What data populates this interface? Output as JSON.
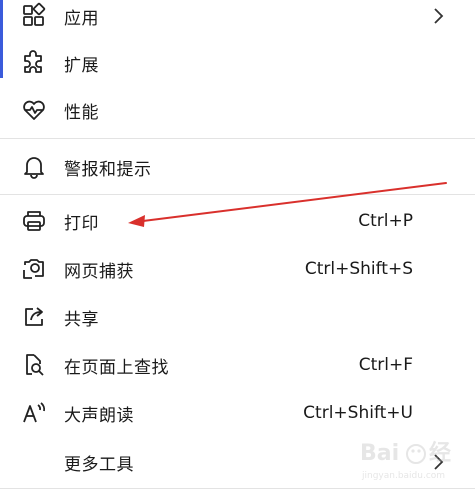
{
  "menu": {
    "items": [
      {
        "label": "应用",
        "shortcut": "",
        "icon": "apps-icon",
        "submenu": true
      },
      {
        "label": "扩展",
        "shortcut": "",
        "icon": "extensions-icon",
        "submenu": false
      },
      {
        "label": "性能",
        "shortcut": "",
        "icon": "performance-icon",
        "submenu": false
      },
      {
        "label": "警报和提示",
        "shortcut": "",
        "icon": "bell-icon",
        "submenu": false
      },
      {
        "label": "打印",
        "shortcut": "Ctrl+P",
        "icon": "printer-icon",
        "submenu": false
      },
      {
        "label": "网页捕获",
        "shortcut": "Ctrl+Shift+S",
        "icon": "web-capture-icon",
        "submenu": false
      },
      {
        "label": "共享",
        "shortcut": "",
        "icon": "share-icon",
        "submenu": false
      },
      {
        "label": "在页面上查找",
        "shortcut": "Ctrl+F",
        "icon": "find-on-page-icon",
        "submenu": false
      },
      {
        "label": "大声朗读",
        "shortcut": "Ctrl+Shift+U",
        "icon": "read-aloud-icon",
        "submenu": false
      },
      {
        "label": "更多工具",
        "shortcut": "",
        "icon": "",
        "submenu": true
      }
    ]
  },
  "annotation": {
    "color": "#d9302c"
  },
  "accent_color": "#3b5bdb"
}
